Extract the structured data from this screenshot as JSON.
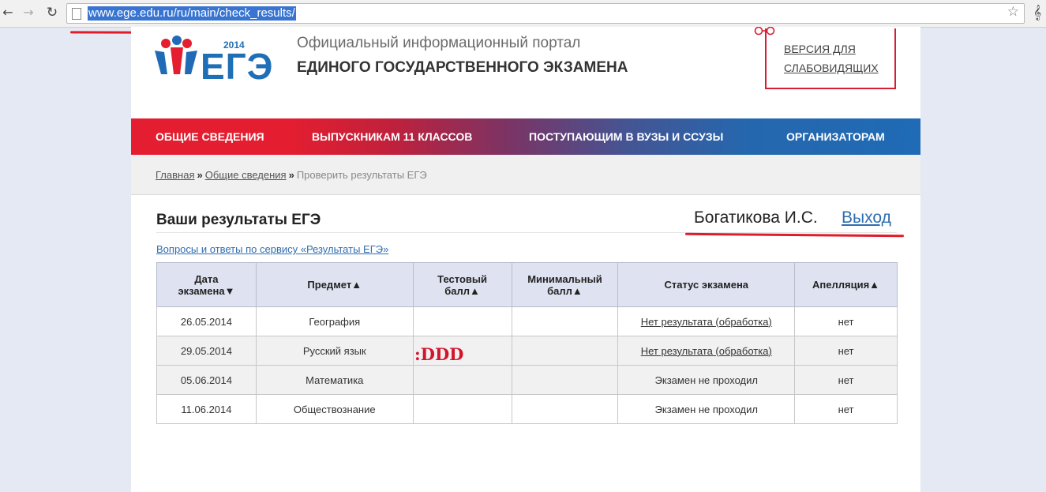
{
  "browser": {
    "url": "www.ege.edu.ru/ru/main/check_results/",
    "back_icon": "←",
    "forward_icon": "→",
    "reload_icon": "↻",
    "star_icon": "☆",
    "menu_icon": "𝄞"
  },
  "header": {
    "logo_text": "ЕГЭ",
    "logo_year": "2014",
    "portal_line1": "Официальный информационный портал",
    "portal_line2": "ЕДИНОГО ГОСУДАРСТВЕННОГО ЭКЗАМЕНА",
    "accessibility_line1": "ВЕРСИЯ ДЛЯ",
    "accessibility_line2": "СЛАБОВИДЯЩИХ"
  },
  "nav": {
    "items": [
      {
        "label": "ОБЩИЕ СВЕДЕНИЯ"
      },
      {
        "label": "ВЫПУСКНИКАМ 11 КЛАССОВ"
      },
      {
        "label": "ПОСТУПАЮЩИМ В ВУЗЫ И ССУЗЫ"
      },
      {
        "label": "ОРГАНИЗАТОРАМ"
      }
    ]
  },
  "breadcrumb": {
    "home": "Главная",
    "section": "Общие сведения",
    "current": "Проверить результаты ЕГЭ",
    "separator": "»"
  },
  "results": {
    "title": "Ваши результаты ЕГЭ",
    "user_name": "Богатикова И.С.",
    "logout_label": "Выход",
    "faq_link": "Вопросы и ответы по сервису «Результаты ЕГЭ»",
    "annotation": ":DDD",
    "columns": [
      {
        "line1": "Дата",
        "line2": "экзамена▼"
      },
      {
        "line1": "Предмет▲",
        "line2": ""
      },
      {
        "line1": "Тестовый",
        "line2": "балл▲"
      },
      {
        "line1": "Минимальный",
        "line2": "балл▲"
      },
      {
        "line1": "Статус экзамена",
        "line2": ""
      },
      {
        "line1": "Апелляция▲",
        "line2": ""
      }
    ],
    "rows": [
      {
        "date": "26.05.2014",
        "subject": "География",
        "score": "",
        "min_score": "",
        "status": "Нет результата (обработка)",
        "appeal": "нет"
      },
      {
        "date": "29.05.2014",
        "subject": "Русский язык",
        "score": "",
        "min_score": "",
        "status": "Нет результата (обработка)",
        "appeal": "нет"
      },
      {
        "date": "05.06.2014",
        "subject": "Математика",
        "score": "",
        "min_score": "",
        "status": "Экзамен не проходил",
        "appeal": "нет"
      },
      {
        "date": "11.06.2014",
        "subject": "Обществознание",
        "score": "",
        "min_score": "",
        "status": "Экзамен не проходил",
        "appeal": "нет"
      }
    ]
  },
  "colors": {
    "nav_red": "#e41e30",
    "nav_blue": "#1f6bb6",
    "link_blue": "#2f6db0",
    "annotation_red": "#d4142a"
  }
}
